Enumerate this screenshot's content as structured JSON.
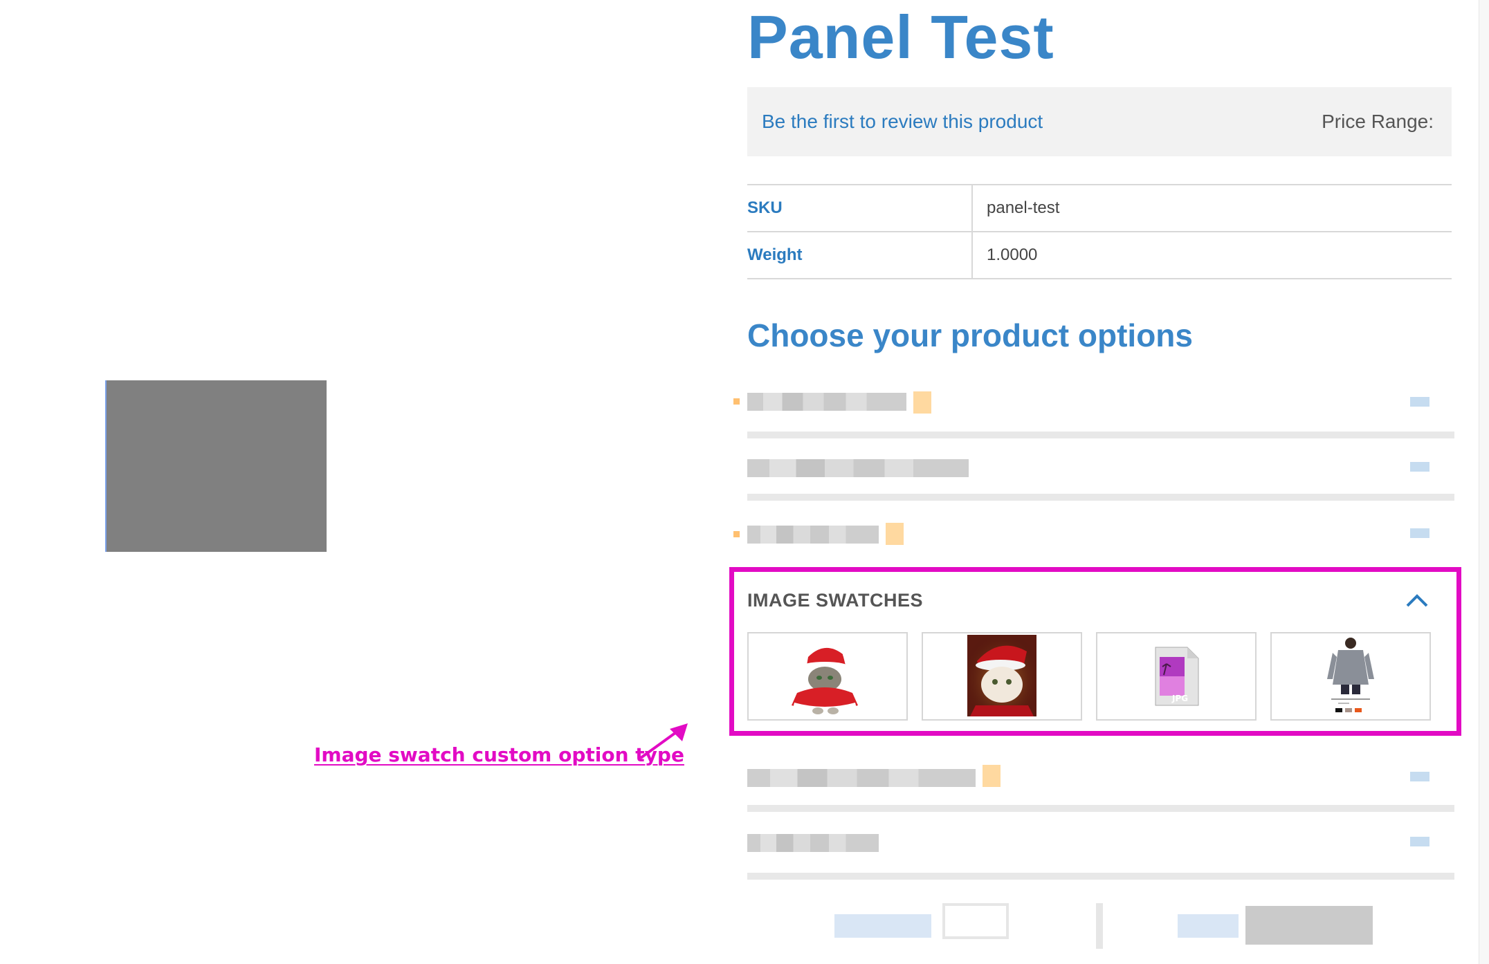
{
  "product": {
    "title": "Panel Test",
    "review_link": "Be the first to review this product",
    "price_range_label": "Price Range:"
  },
  "specs": [
    {
      "label": "SKU",
      "value": "panel-test"
    },
    {
      "label": "Weight",
      "value": "1.0000"
    }
  ],
  "options": {
    "section_title": "Choose your product options",
    "image_swatches": {
      "title": "IMAGE SWATCHES",
      "items": [
        {
          "name": "cat-in-santa-suit"
        },
        {
          "name": "santa-cat-portrait"
        },
        {
          "name": "jpg-file-icon"
        },
        {
          "name": "hoodie-product-card"
        }
      ]
    }
  },
  "annotation": {
    "text": "Image swatch custom option type",
    "color": "#e20bc4"
  },
  "colors": {
    "primary_blue": "#3a86c8",
    "link_blue": "#2b7bbf",
    "highlight_magenta": "#e20bc4"
  }
}
